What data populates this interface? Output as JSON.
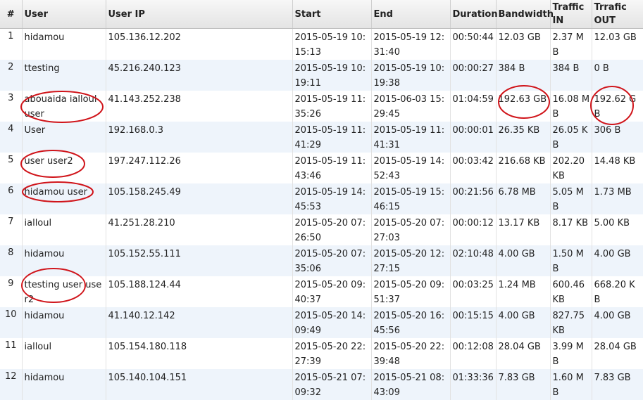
{
  "headers": [
    "#",
    "User",
    "User IP",
    "Start",
    "End",
    "Duration",
    "Bandwidth",
    "Traffic IN",
    "Trrafic OUT"
  ],
  "rows": [
    [
      "1",
      "hidamou",
      "105.136.12.202",
      "2015-05-19 10:15:13",
      "2015-05-19 12:31:40",
      "00:50:44",
      "12.03 GB",
      "2.37 MB",
      "12.03 GB"
    ],
    [
      "2",
      "ttesting",
      "45.216.240.123",
      "2015-05-19 10:19:11",
      "2015-05-19 10:19:38",
      "00:00:27",
      "384 B",
      "384 B",
      "0 B"
    ],
    [
      "3",
      "abouaida ialloul user",
      "41.143.252.238",
      "2015-05-19 11:35:26",
      "2015-06-03 15:29:45",
      "01:04:59",
      "192.63 GB",
      "16.08 MB",
      "192.62 GB"
    ],
    [
      "4",
      "User",
      "192.168.0.3",
      "2015-05-19 11:41:29",
      "2015-05-19 11:41:31",
      "00:00:01",
      "26.35 KB",
      "26.05 KB",
      "306 B"
    ],
    [
      "5",
      "user user2",
      "197.247.112.26",
      "2015-05-19 11:43:46",
      "2015-05-19 14:52:43",
      "00:03:42",
      "216.68 KB",
      "202.20 KB",
      "14.48 KB"
    ],
    [
      "6",
      "hidamou user",
      "105.158.245.49",
      "2015-05-19 14:45:53",
      "2015-05-19 15:46:15",
      "00:21:56",
      "6.78 MB",
      "5.05 MB",
      "1.73 MB"
    ],
    [
      "7",
      "ialloul",
      "41.251.28.210",
      "2015-05-20 07:26:50",
      "2015-05-20 07:27:03",
      "00:00:12",
      "13.17 KB",
      "8.17 KB",
      "5.00 KB"
    ],
    [
      "8",
      "hidamou",
      "105.152.55.111",
      "2015-05-20 07:35:06",
      "2015-05-20 12:27:15",
      "02:10:48",
      "4.00 GB",
      "1.50 MB",
      "4.00 GB"
    ],
    [
      "9",
      "ttesting user user2",
      "105.188.124.44",
      "2015-05-20 09:40:37",
      "2015-05-20 09:51:37",
      "00:03:25",
      "1.24 MB",
      "600.46 KB",
      "668.20 KB"
    ],
    [
      "10",
      "hidamou",
      "41.140.12.142",
      "2015-05-20 14:09:49",
      "2015-05-20 16:45:56",
      "00:15:15",
      "4.00 GB",
      "827.75 KB",
      "4.00 GB"
    ],
    [
      "11",
      "ialloul",
      "105.154.180.118",
      "2015-05-20 22:27:39",
      "2015-05-20 22:39:48",
      "00:12:08",
      "28.04 GB",
      "3.99 MB",
      "28.04 GB"
    ],
    [
      "12",
      "hidamou",
      "105.140.104.151",
      "2015-05-21 07:09:32",
      "2015-05-21 08:43:09",
      "01:33:36",
      "7.83 GB",
      "1.60 MB",
      "7.83 GB"
    ]
  ],
  "colors": {
    "header_bg": "#e8e8e8",
    "row_alt_bg": "#eef4fb",
    "annotation": "#d0141a"
  }
}
